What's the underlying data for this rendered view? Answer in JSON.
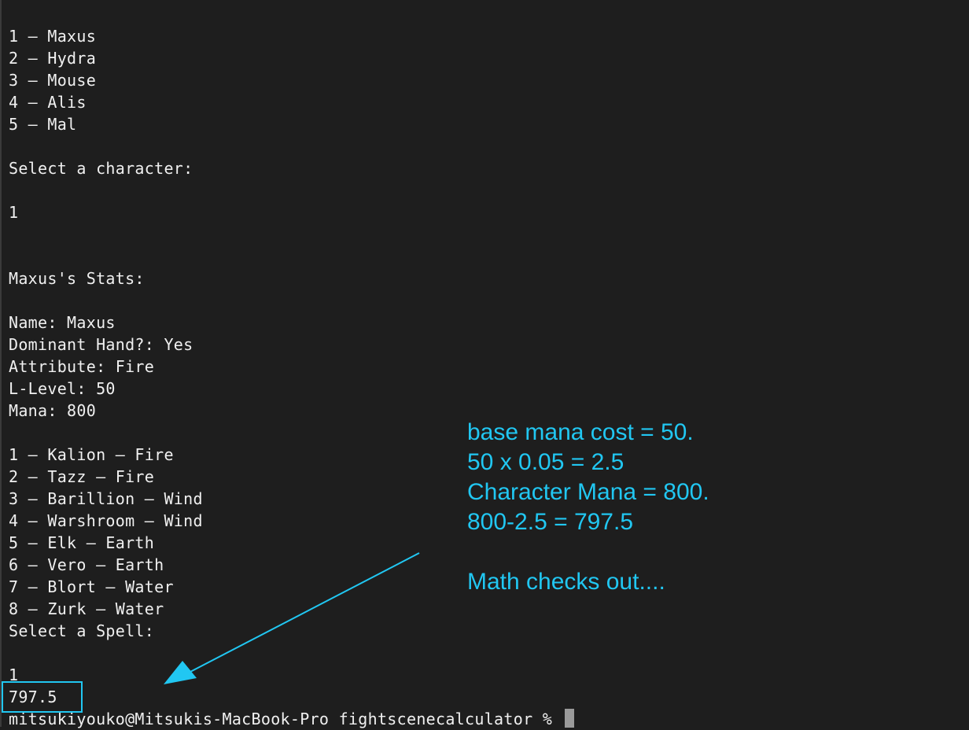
{
  "terminal": {
    "lines": [
      "1 – Maxus",
      "2 – Hydra",
      "3 – Mouse",
      "4 – Alis",
      "5 – Mal",
      "",
      "Select a character:",
      "",
      "1",
      "",
      "",
      "Maxus's Stats:",
      "",
      "Name: Maxus",
      "Dominant Hand?: Yes",
      "Attribute: Fire",
      "L-Level: 50",
      "Mana: 800",
      "",
      "1 – Kalion – Fire",
      "2 – Tazz – Fire",
      "3 – Barillion – Wind",
      "4 – Warshroom – Wind",
      "5 – Elk – Earth",
      "6 – Vero – Earth",
      "7 – Blort – Water",
      "8 – Zurk – Water",
      "Select a Spell:",
      "",
      "1",
      "797.5"
    ],
    "prompt": "mitsukiyouko@Mitsukis-MacBook-Pro fightscenecalculator % "
  },
  "annotation": {
    "lines": [
      "base mana cost = 50.",
      "50 x 0.05 = 2.5",
      "Character Mana = 800.",
      "800-2.5 = 797.5",
      "",
      "Math checks out...."
    ]
  },
  "colors": {
    "background": "#1e1e1e",
    "terminal_text": "#f0f0f0",
    "annotation_accent": "#21c7f2",
    "cursor": "#9a9a9a"
  }
}
